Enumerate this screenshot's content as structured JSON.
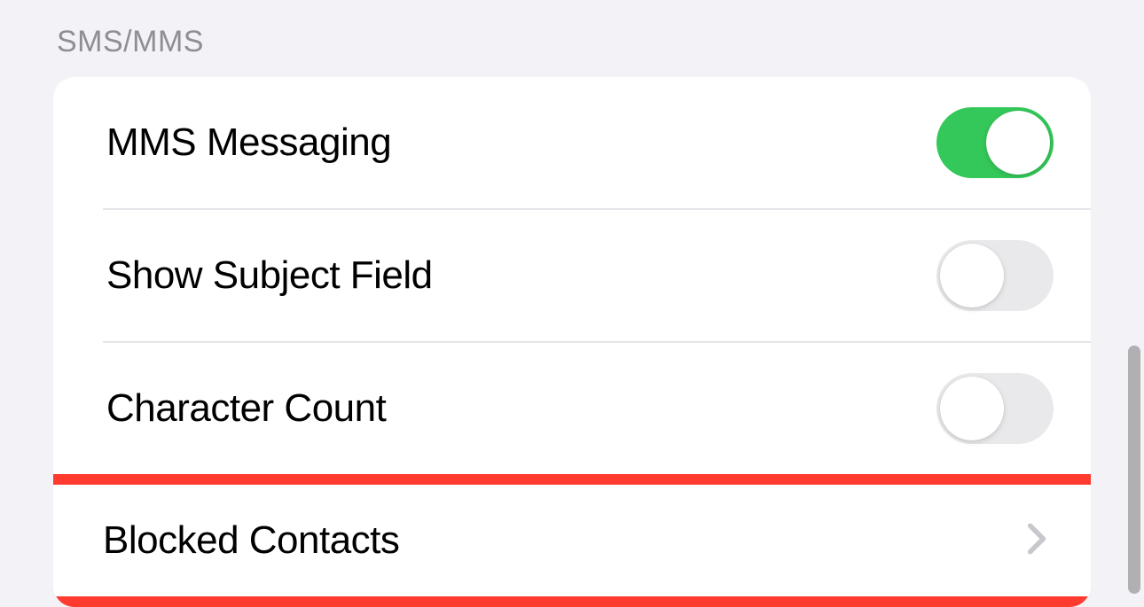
{
  "section": {
    "header": "SMS/MMS",
    "rows": [
      {
        "label": "MMS Messaging",
        "type": "toggle",
        "value": true
      },
      {
        "label": "Show Subject Field",
        "type": "toggle",
        "value": false
      },
      {
        "label": "Character Count",
        "type": "toggle",
        "value": false
      },
      {
        "label": "Blocked Contacts",
        "type": "navigation",
        "highlighted": true
      }
    ]
  }
}
